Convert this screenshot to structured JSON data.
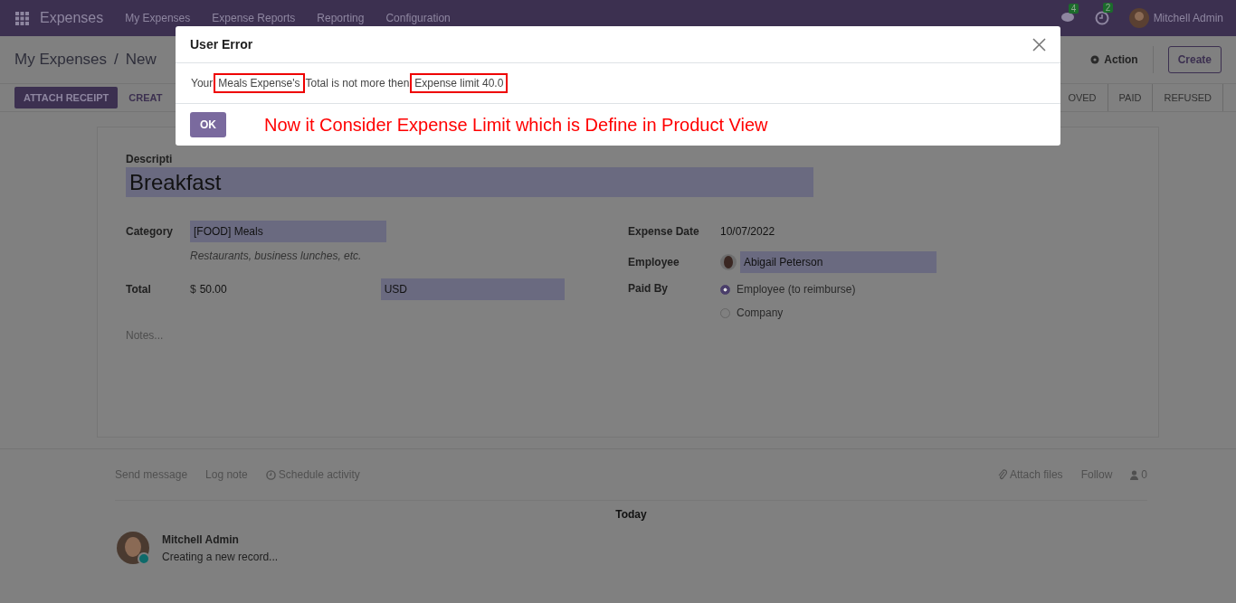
{
  "navbar": {
    "app_name": "Expenses",
    "menu": [
      "My Expenses",
      "Expense Reports",
      "Reporting",
      "Configuration"
    ],
    "messages_count": "4",
    "activities_count": "2",
    "user": "Mitchell Admin"
  },
  "control_panel": {
    "breadcrumb": [
      "My Expenses",
      "New"
    ],
    "breadcrumb_separator": "/",
    "action": "Action",
    "create": "Create",
    "buttons": [
      "ATTACH RECEIPT",
      "CREAT"
    ],
    "stages": [
      {
        "label": "OVED",
        "selected": false
      },
      {
        "label": "PAID",
        "selected": false
      },
      {
        "label": "REFUSED",
        "selected": false
      }
    ]
  },
  "form": {
    "description_label": "Descripti",
    "description": "Breakfast",
    "category_label": "Category",
    "category": "[FOOD] Meals",
    "category_hint": "Restaurants, business lunches, etc.",
    "total_label": "Total",
    "currency_symbol": "$",
    "total": "50.00",
    "currency": "USD",
    "notes_placeholder": "Notes...",
    "expense_date_label": "Expense Date",
    "expense_date": "10/07/2022",
    "employee_label": "Employee",
    "employee": "Abigail Peterson",
    "paid_by_label": "Paid By",
    "paid_by": [
      {
        "label": "Employee (to reimburse)",
        "selected": true
      },
      {
        "label": "Company",
        "selected": false
      }
    ]
  },
  "chatter": {
    "send_message": "Send message",
    "log_note": "Log note",
    "schedule_activity": "Schedule activity",
    "attach_files": "Attach files",
    "follow": "Follow",
    "followers": "0",
    "date_separator": "Today",
    "messages": [
      {
        "author": "Mitchell Admin",
        "body": "Creating a new record..."
      }
    ]
  },
  "dialog": {
    "title": "User Error",
    "message_parts": [
      "Your",
      "Meals Expense's",
      "Total is not more then",
      "Expense limit 40.0"
    ],
    "ok": "OK",
    "annotation": "Now it Consider Expense Limit which is Define in Product View"
  }
}
